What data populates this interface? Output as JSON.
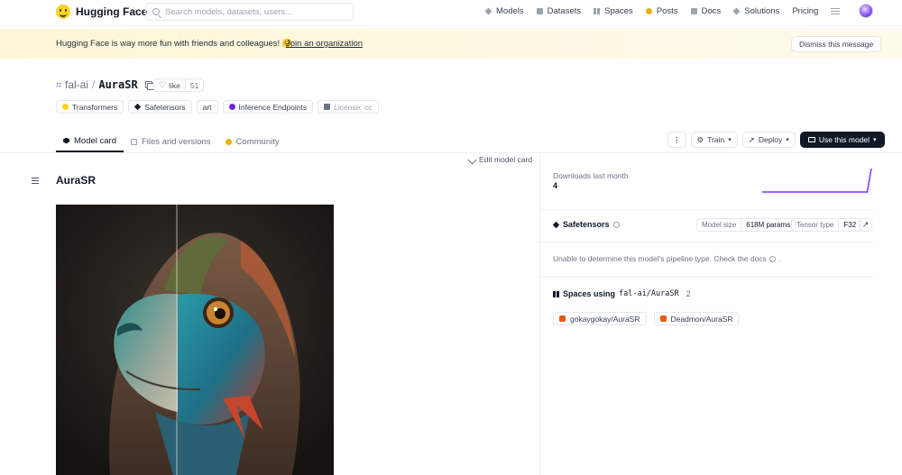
{
  "nav": {
    "brand": "Hugging Face",
    "search_placeholder": "Search models, datasets, users...",
    "links": [
      {
        "label": "Models",
        "icon": "models-icon"
      },
      {
        "label": "Datasets",
        "icon": "datasets-icon"
      },
      {
        "label": "Spaces",
        "icon": "spaces-icon"
      },
      {
        "label": "Posts",
        "icon": "posts-icon"
      },
      {
        "label": "Docs",
        "icon": "docs-icon"
      },
      {
        "label": "Solutions",
        "icon": "solutions-icon"
      },
      {
        "label": "Pricing"
      }
    ]
  },
  "banner": {
    "message": "Hugging Face is way more fun with friends and colleagues! 🤗",
    "join": "Join an organization",
    "dismiss": "Dismiss this message"
  },
  "model": {
    "org": "fal-ai",
    "separator": "/",
    "name": "AuraSR",
    "like_label": "like",
    "like_count": "51",
    "tags": [
      "Transformers",
      "Safetensors",
      "art",
      "Inference Endpoints",
      "License: cc"
    ]
  },
  "tabs": {
    "model_card": "Model card",
    "files": "Files and versions",
    "community": "Community"
  },
  "actions": {
    "more": "⋮",
    "train": "Train",
    "deploy": "Deploy",
    "use": "Use this model"
  },
  "card": {
    "edit": "Edit model card",
    "heading": "AuraSR"
  },
  "sidebar": {
    "downloads_label": "Downloads last month",
    "downloads_value": "4",
    "downloads_series": [
      0,
      0,
      0,
      0,
      0,
      0,
      0,
      0,
      0,
      0,
      0,
      0,
      0,
      0,
      0,
      0,
      0,
      0,
      0,
      0,
      0,
      0,
      0,
      0,
      0,
      0,
      4
    ],
    "safetensors": "Safetensors",
    "model_size_label": "Model size",
    "model_size_value": "618M params",
    "tensor_type_label": "Tensor type",
    "tensor_type_value": "F32",
    "pipeline_note": "Unable to determine this model's pipeline type. Check the docs",
    "spaces_prefix": "Spaces using",
    "spaces_repo": "fal-ai/AuraSR",
    "spaces_count": "2",
    "spaces": [
      "gokaygokay/AuraSR",
      "Deadmon/AuraSR"
    ]
  },
  "colors": {
    "accent": "#111827",
    "banner_bg": "#fdf6d8",
    "spark": "#7c3aed"
  }
}
